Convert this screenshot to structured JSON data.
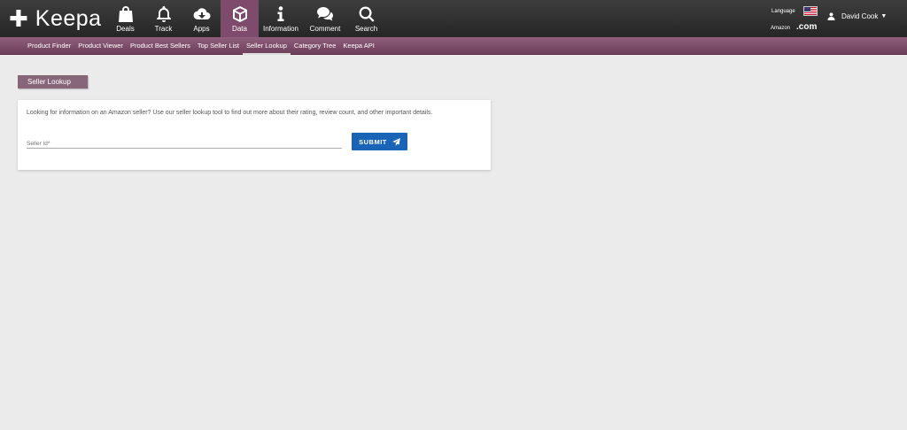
{
  "brand": {
    "name": "Keepa"
  },
  "nav": {
    "items": [
      {
        "label": "Deals",
        "icon": "shopping-bag-icon"
      },
      {
        "label": "Track",
        "icon": "bell-icon"
      },
      {
        "label": "Apps",
        "icon": "cloud-download-icon"
      },
      {
        "label": "Data",
        "icon": "cube-icon",
        "active": true
      },
      {
        "label": "Information",
        "icon": "info-icon"
      },
      {
        "label": "Comment",
        "icon": "comments-icon"
      },
      {
        "label": "Search",
        "icon": "search-icon"
      }
    ]
  },
  "locale": {
    "language_label": "Language",
    "marketplace_label": "Amazon",
    "domain": ".com",
    "flag": "us-flag-icon"
  },
  "user": {
    "name": "David Cook"
  },
  "subnav": {
    "items": [
      {
        "label": "Product Finder"
      },
      {
        "label": "Product Viewer"
      },
      {
        "label": "Product Best Sellers"
      },
      {
        "label": "Top Seller List"
      },
      {
        "label": "Seller Lookup",
        "active": true
      },
      {
        "label": "Category Tree"
      },
      {
        "label": "Keepa API"
      }
    ]
  },
  "section": {
    "title": "Seller Lookup"
  },
  "card": {
    "description": "Looking for information on an Amazon seller? Use our seller lookup tool to find out more about their rating, review count, and other important details.",
    "seller_id_placeholder": "Seller Id*",
    "submit_label": "SUBMIT"
  },
  "colors": {
    "topbar": "#2f2f2f",
    "accent": "#7e4b6c",
    "subnav": "#7e4e6b",
    "button": "#1a64b8",
    "background": "#ebebeb"
  }
}
